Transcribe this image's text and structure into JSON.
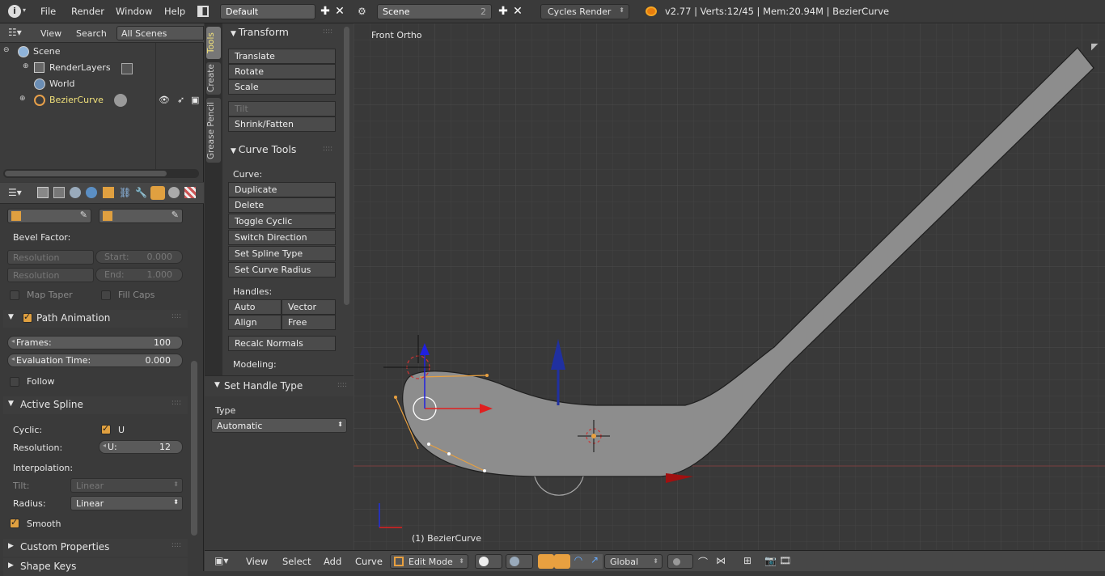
{
  "topbar": {
    "menus": [
      "File",
      "Render",
      "Window",
      "Help"
    ],
    "layout_name": "Default",
    "scene_name": "Scene",
    "scene_users": "2",
    "engine": "Cycles Render",
    "status": "v2.77 | Verts:12/45 | Mem:20.94M | BezierCurve"
  },
  "outliner": {
    "view": "View",
    "search": "Search",
    "filter": "All Scenes",
    "items": [
      "Scene",
      "RenderLayers",
      "World",
      "BezierCurve"
    ]
  },
  "properties": {
    "bevel_factor": "Bevel Factor:",
    "resolution_a": "Resolution",
    "start_label": "Start:",
    "start_value": "0.000",
    "resolution_b": "Resolution",
    "end_label": "End:",
    "end_value": "1.000",
    "map_taper": "Map Taper",
    "fill_caps": "Fill Caps",
    "path_animation": "Path Animation",
    "frames_label": "Frames:",
    "frames_value": "100",
    "eval_label": "Evaluation Time:",
    "eval_value": "0.000",
    "follow": "Follow",
    "active_spline": "Active Spline",
    "cyclic": "Cyclic:",
    "cyclic_u": "U",
    "resolution_label": "Resolution:",
    "u_label": "U:",
    "u_value": "12",
    "interpolation": "Interpolation:",
    "tilt": "Tilt:",
    "tilt_value": "Linear",
    "radius": "Radius:",
    "radius_value": "Linear",
    "smooth": "Smooth",
    "custom_properties": "Custom Properties",
    "shape_keys": "Shape Keys"
  },
  "tabs": [
    "Tools",
    "Create",
    "Grease Pencil"
  ],
  "toolshelf": {
    "transform": "Transform",
    "translate": "Translate",
    "rotate": "Rotate",
    "scale": "Scale",
    "tilt": "Tilt",
    "shrink": "Shrink/Fatten",
    "curve_tools": "Curve Tools",
    "curve_label": "Curve:",
    "duplicate": "Duplicate",
    "delete": "Delete",
    "toggle_cyclic": "Toggle Cyclic",
    "switch_direction": "Switch Direction",
    "set_spline_type": "Set Spline Type",
    "set_curve_radius": "Set Curve Radius",
    "handles_label": "Handles:",
    "auto": "Auto",
    "vector": "Vector",
    "align": "Align",
    "free": "Free",
    "recalc_normals": "Recalc Normals",
    "modeling": "Modeling:"
  },
  "operator": {
    "title": "Set Handle Type",
    "type_label": "Type",
    "type_value": "Automatic"
  },
  "viewport": {
    "view_name": "Front Ortho",
    "object_label": "(1) BezierCurve"
  },
  "bottombar": {
    "view": "View",
    "select": "Select",
    "add": "Add",
    "curve": "Curve",
    "mode": "Edit Mode",
    "orientation": "Global"
  }
}
